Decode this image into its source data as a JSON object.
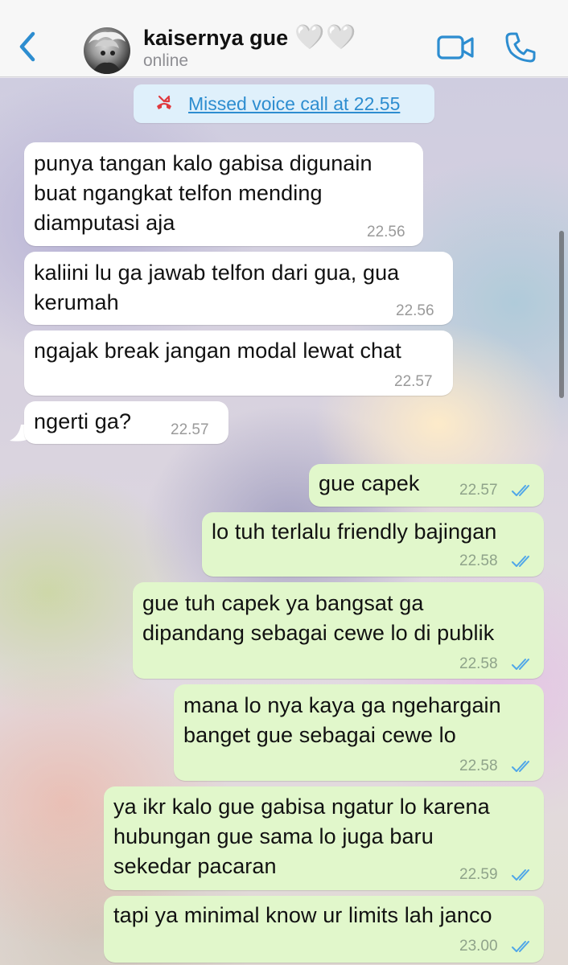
{
  "header": {
    "back_label": "back",
    "contact_name": "kaisernya gue",
    "name_emoji": "🤍🤍",
    "status": "online",
    "colors": {
      "accent": "#2d8dd0",
      "header_bg": "#f7f7f7"
    }
  },
  "system_message": {
    "icon": "missed-call-icon",
    "text": "Missed voice call at 22.55"
  },
  "messages": [
    {
      "direction": "in",
      "text": "punya tangan kalo gabisa digunain\nbuat ngangkat telfon mending\ndiamputasi aja",
      "time": "22.56"
    },
    {
      "direction": "in",
      "text": "kaliini lu ga jawab telfon dari gua, gua\nkerumah",
      "time": "22.56"
    },
    {
      "direction": "in",
      "text": "ngajak break jangan modal lewat chat",
      "time": "22.57"
    },
    {
      "direction": "in",
      "text": "ngerti ga?",
      "time": "22.57"
    },
    {
      "direction": "out",
      "text": "gue capek",
      "time": "22.57",
      "status": "read"
    },
    {
      "direction": "out",
      "text": "lo tuh terlalu friendly bajingan",
      "time": "22.58",
      "status": "read"
    },
    {
      "direction": "out",
      "text": "gue tuh capek ya bangsat ga\ndipandang sebagai cewe lo di publik",
      "time": "22.58",
      "status": "read"
    },
    {
      "direction": "out",
      "text": "mana lo nya kaya ga ngehargain\nbanget gue sebagai cewe lo",
      "time": "22.58",
      "status": "read"
    },
    {
      "direction": "out",
      "text": "ya ikr kalo gue gabisa ngatur lo karena\nhubungan gue sama lo juga baru\nsekedar pacaran",
      "time": "22.59",
      "status": "read"
    },
    {
      "direction": "out",
      "text": "tapi ya minimal know ur limits lah janco",
      "time": "23.00",
      "status": "read"
    }
  ]
}
